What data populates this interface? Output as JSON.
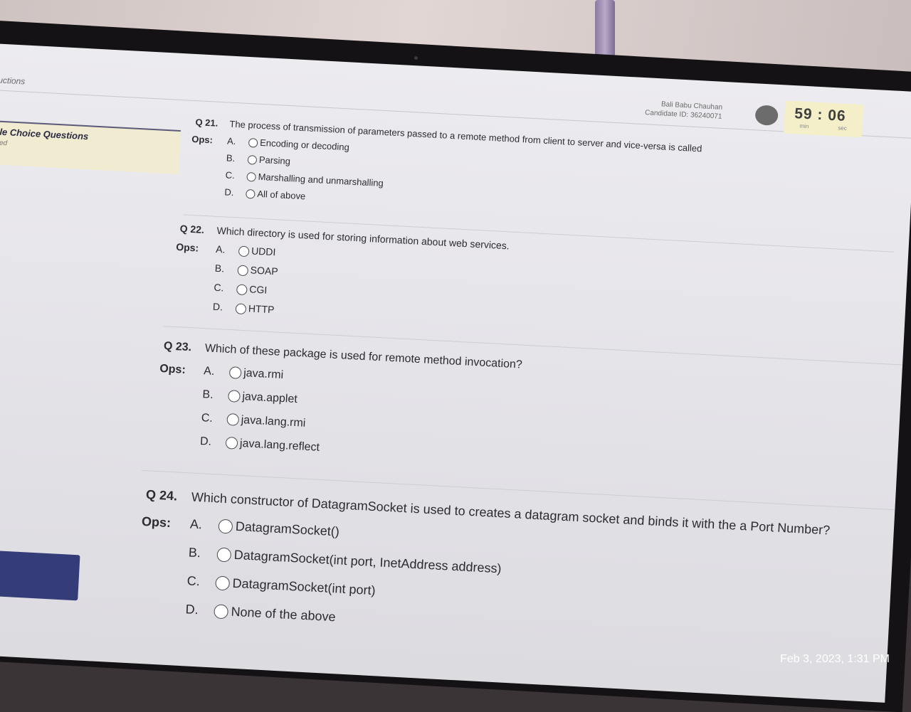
{
  "breadcrumb": "uctions",
  "sidebar": {
    "title": "ple Choice Questions",
    "subtitle": "pted"
  },
  "candidate": {
    "name": "Bali Babu Chauhan",
    "id_line": "Candidate ID: 36240071"
  },
  "timer": {
    "display": "59 : 06",
    "min_label": "min",
    "sec_label": "sec"
  },
  "questions": [
    {
      "number": "Q 21.",
      "text": "The process of transmission of parameters passed to a remote method from client to server and vice-versa is called",
      "ops_label": "Ops:",
      "options": [
        {
          "letter": "A.",
          "text": "Encoding or decoding"
        },
        {
          "letter": "B.",
          "text": "Parsing"
        },
        {
          "letter": "C.",
          "text": "Marshalling and unmarshalling"
        },
        {
          "letter": "D.",
          "text": "All of above"
        }
      ]
    },
    {
      "number": "Q 22.",
      "text": "Which directory is used for storing information about web services.",
      "ops_label": "Ops:",
      "options": [
        {
          "letter": "A.",
          "text": "UDDI"
        },
        {
          "letter": "B.",
          "text": "SOAP"
        },
        {
          "letter": "C.",
          "text": "CGI"
        },
        {
          "letter": "D.",
          "text": "HTTP"
        }
      ]
    },
    {
      "number": "Q 23.",
      "text": "Which of these package is used for remote method invocation?",
      "ops_label": "Ops:",
      "options": [
        {
          "letter": "A.",
          "text": "java.rmi"
        },
        {
          "letter": "B.",
          "text": "java.applet"
        },
        {
          "letter": "C.",
          "text": "java.lang.rmi"
        },
        {
          "letter": "D.",
          "text": "java.lang.reflect"
        }
      ]
    },
    {
      "number": "Q 24.",
      "text": "Which constructor of DatagramSocket is used to creates a datagram socket and binds it with the a Port Number?",
      "ops_label": "Ops:",
      "options": [
        {
          "letter": "A.",
          "text": "DatagramSocket()"
        },
        {
          "letter": "B.",
          "text": "DatagramSocket(int port, InetAddress address)"
        },
        {
          "letter": "C.",
          "text": "DatagramSocket(int port)"
        },
        {
          "letter": "D.",
          "text": "None of the above"
        }
      ]
    }
  ],
  "photo_timestamp": "Feb 3, 2023, 1:31 PM"
}
